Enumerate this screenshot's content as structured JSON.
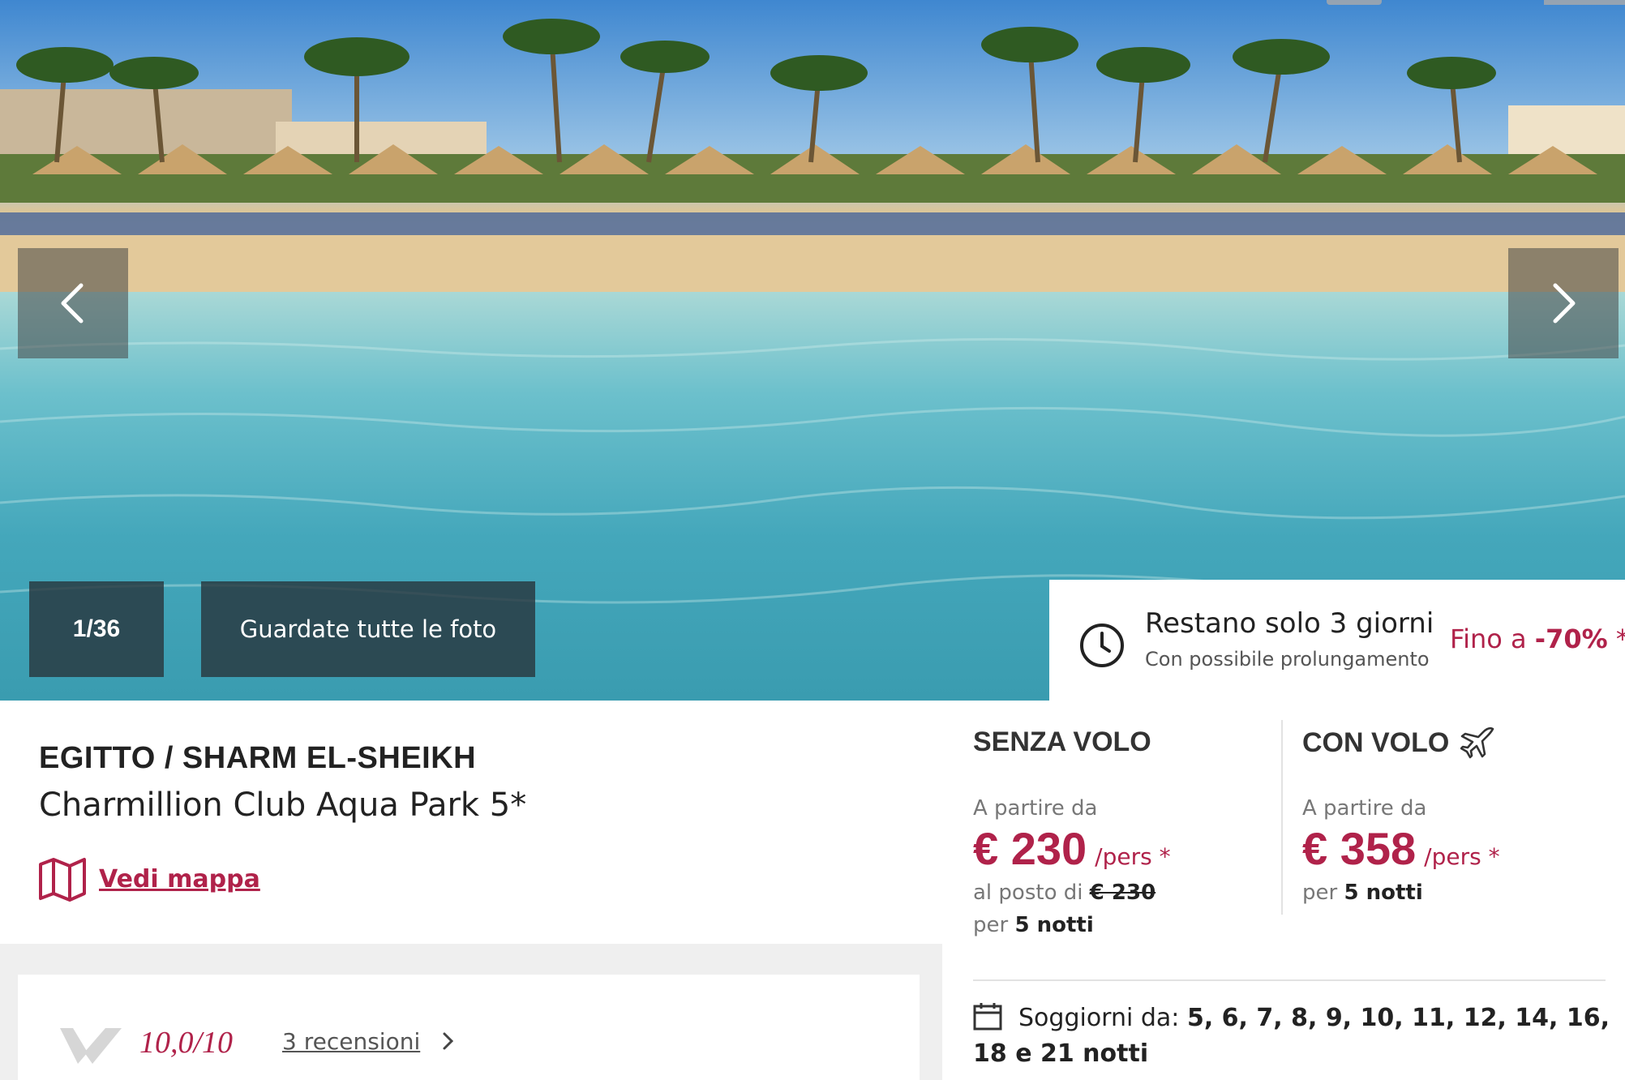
{
  "gallery": {
    "counter": "1/36",
    "all_photos_label": "Guardate tutte le foto"
  },
  "offer_timer": {
    "title": "Restano solo 3 giorni",
    "subtitle": "Con possibile prolungamento",
    "discount_prefix": "Fino a",
    "discount_value": "-70%",
    "discount_suffix": "*"
  },
  "hotel": {
    "breadcrumb": "EGITTO / SHARM EL-SHEIKH",
    "name": "Charmillion Club Aqua Park 5*",
    "map_link": "Vedi mappa"
  },
  "reviews": {
    "score": "10,0/10",
    "link": "3 recensioni"
  },
  "pricing": {
    "without_flight": {
      "heading": "SENZA VOLO",
      "from_label": "A partire da",
      "price": "€ 230",
      "per": "/pers *",
      "instead_label": "al posto di",
      "instead_price": "€ 230",
      "nights_prefix": "per",
      "nights": "5 notti"
    },
    "with_flight": {
      "heading": "CON VOLO",
      "from_label": "A partire da",
      "price": "€ 358",
      "per": "/pers *",
      "nights_prefix": "per",
      "nights": "5 notti"
    },
    "stays": {
      "label": "Soggiorni da:",
      "values": "5, 6, 7, 8, 9, 10, 11, 12, 14, 16, 18 e 21 notti"
    }
  },
  "colors": {
    "accent": "#b0224a",
    "overlay": "#28373e"
  },
  "icons": [
    "chevron-left-icon",
    "chevron-right-icon",
    "clock-icon",
    "map-icon",
    "airplane-icon",
    "calendar-icon",
    "review-logo-icon",
    "chevron-right-small-icon"
  ]
}
